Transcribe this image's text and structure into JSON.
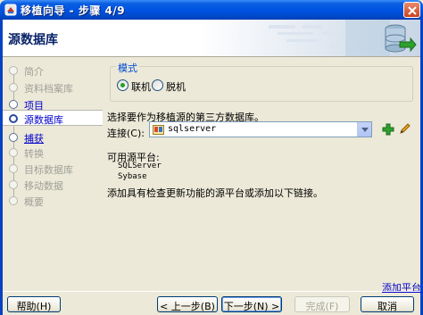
{
  "window": {
    "title": "移植向导 - 步骤 4/9",
    "icons": {
      "app": "app-window-icon",
      "close": "close-icon"
    }
  },
  "header": {
    "title": "源数据库",
    "graphic": "database-banner-graphic"
  },
  "nav": {
    "items": [
      {
        "label": "简介",
        "state": "done"
      },
      {
        "label": "资料档案库",
        "state": "done"
      },
      {
        "label": "项目",
        "state": "link"
      },
      {
        "label": "源数据库",
        "state": "current"
      },
      {
        "label": "捕获",
        "state": "link"
      },
      {
        "label": "转换",
        "state": "future"
      },
      {
        "label": "目标数据库",
        "state": "future"
      },
      {
        "label": "移动数据",
        "state": "future"
      },
      {
        "label": "概要",
        "state": "future"
      }
    ]
  },
  "mode": {
    "legend": "模式",
    "online_label": "联机",
    "offline_label": "脱机",
    "selected": "online"
  },
  "connection": {
    "prompt": "选择要作为移植源的第三方数据库。",
    "label": "连接(C):",
    "value": "sqlserver",
    "icons": {
      "db": "database-icon",
      "dropdown": "chevron-down-icon",
      "add": "add-icon",
      "edit": "pencil-icon"
    }
  },
  "platforms": {
    "heading": "可用源平台:",
    "items": [
      "SQLServer",
      "Sybase"
    ],
    "hint": "添加具有检查更新功能的源平台或添加以下链接。",
    "add_link": "添加平台"
  },
  "buttons": {
    "help": "帮助(H)",
    "back": "< 上一步(B)",
    "next": "下一步(N) >",
    "finish": "完成(F)",
    "cancel": "取消"
  }
}
